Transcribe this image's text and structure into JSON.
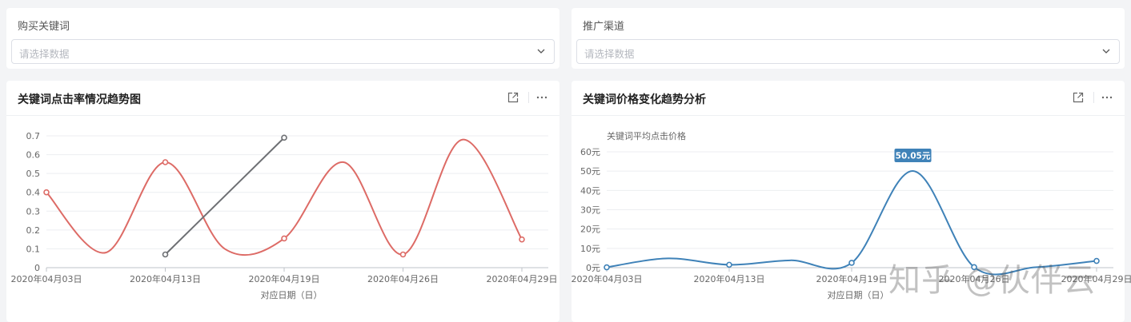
{
  "filters": [
    {
      "label": "购买关键词",
      "placeholder": "请选择数据"
    },
    {
      "label": "推广渠道",
      "placeholder": "请选择数据"
    }
  ],
  "charts": {
    "ctr": {
      "title": "关键词点击率情况趋势图",
      "xlabel": "对应日期（日）",
      "ytick_labels": [
        "0",
        "0.1",
        "0.2",
        "0.3",
        "0.4",
        "0.5",
        "0.6",
        "0.7"
      ],
      "xtick_labels": [
        "2020年04月03日",
        "2020年04月13日",
        "2020年04月19日",
        "2020年04月26日",
        "2020年04月29日"
      ]
    },
    "price": {
      "title": "关键词价格变化趋势分析",
      "ylabel": "关键词平均点击价格",
      "xlabel": "对应日期（日）",
      "ytick_labels": [
        "0元",
        "10元",
        "20元",
        "30元",
        "40元",
        "50元",
        "60元"
      ],
      "xtick_labels": [
        "2020年04月03日",
        "2020年04月13日",
        "2020年04月19日",
        "2020年04月26日",
        "2020年04月29日"
      ],
      "tooltip": "50.05元"
    }
  },
  "chart_data": [
    {
      "type": "line",
      "title": "关键词点击率情况趋势图",
      "xlabel": "对应日期（日）",
      "ylabel": "",
      "ylim": [
        0,
        0.7
      ],
      "grid": true,
      "categories": [
        "2020年04月03日",
        "2020年04月13日",
        "2020年04月19日",
        "2020年04月26日",
        "2020年04月29日"
      ],
      "series": [
        {
          "color": "#dd6b66",
          "points": [
            [
              0,
              0.4
            ],
            [
              0.5,
              0.08
            ],
            [
              1,
              0.56
            ],
            [
              1.5,
              0.1
            ],
            [
              2,
              0.155
            ],
            [
              2.5,
              0.56
            ],
            [
              3,
              0.07
            ],
            [
              3.5,
              0.68
            ],
            [
              4,
              0.15
            ]
          ],
          "markers": [
            0,
            2,
            4,
            6,
            8
          ]
        },
        {
          "color": "#6e7074",
          "points": [
            [
              1,
              0.07
            ],
            [
              2,
              0.69
            ]
          ],
          "markers": [
            0,
            1
          ]
        }
      ]
    },
    {
      "type": "line",
      "title": "关键词价格变化趋势分析",
      "xlabel": "对应日期（日）",
      "ylabel": "关键词平均点击价格",
      "ylim": [
        0,
        60
      ],
      "grid": true,
      "categories": [
        "2020年04月03日",
        "2020年04月13日",
        "2020年04月19日",
        "2020年04月26日",
        "2020年04月29日"
      ],
      "series": [
        {
          "color": "#3f82b8",
          "points": [
            [
              0,
              0.2
            ],
            [
              0.5,
              4.8
            ],
            [
              1,
              1.5
            ],
            [
              1.5,
              3.8
            ],
            [
              2,
              2.5
            ],
            [
              2.5,
              50.05
            ],
            [
              3,
              0.3
            ],
            [
              3.5,
              0.2
            ],
            [
              4,
              3.5
            ]
          ],
          "markers": [
            0,
            2,
            4,
            6,
            8
          ],
          "label": "50.05元"
        }
      ]
    }
  ],
  "colors": {
    "accent": "#3f82b8",
    "ctr_red": "#dd6b66",
    "ctr_gray": "#6e7074"
  },
  "watermark": "知乎 @伙伴云"
}
